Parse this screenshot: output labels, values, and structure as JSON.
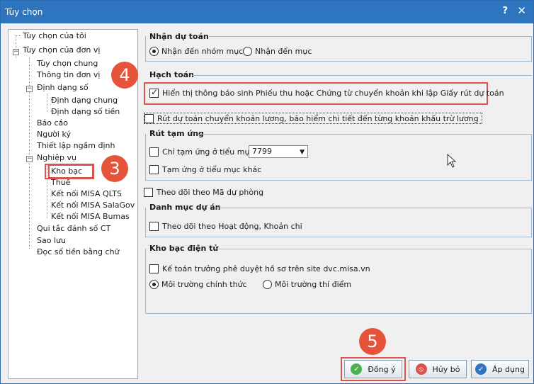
{
  "window": {
    "title": "Tùy chọn",
    "help": "?",
    "close": "✕"
  },
  "tree": {
    "items": [
      "Tùy chọn của tôi",
      "Tùy chọn của đơn vị",
      "Tùy chọn chung",
      "Thông tin đơn vị",
      "Định dạng số",
      "Định dạng chung",
      "Định dạng số tiền",
      "Báo cáo",
      "Người ký",
      "Thiết lập ngầm định",
      "Nghiệp vụ",
      "Kho bạc",
      "Thuế",
      "Kết nối MISA QLTS",
      "Kết nối MISA SalaGov",
      "Kết nối MISA Bumas",
      "Qui tắc đánh số CT",
      "Sao lưu",
      "Đọc số tiền bằng chữ"
    ]
  },
  "nhan_du_toan": {
    "title": "Nhận dự toán",
    "opt1": "Nhận đến nhóm mục",
    "opt2": "Nhận đến mục"
  },
  "hach_toan": {
    "title": "Hạch toán",
    "chk1": "Hiển thị thông báo sinh Phiếu thu hoặc Chứng từ chuyển khoản khi lập Giấy rút dự toán"
  },
  "rut_du_toan": "Rút dự toán chuyển khoản lương, bảo hiểm chi tiết đến từng khoản khấu trừ lương",
  "rut_tam_ung": {
    "title": "Rút tạm ứng",
    "chk1": "Chỉ tạm ứng ở tiểu mục",
    "select_value": "7799",
    "chk2": "Tạm ứng ở tiểu mục khác"
  },
  "theo_doi_ma_du_phong": "Theo dõi theo Mã dự phòng",
  "danh_muc_du_an": {
    "title": "Danh mục dự án",
    "chk1": "Theo dõi theo Hoạt động, Khoản chi"
  },
  "kho_bac_dien_tu": {
    "title": "Kho bạc điện tử",
    "chk1": "Kế toán trưởng phê duyệt hồ sơ trên site dvc.misa.vn",
    "opt1": "Môi trường chính thức",
    "opt2": "Môi trường thí điểm"
  },
  "buttons": {
    "ok": "Đồng ý",
    "cancel": "Hủy bỏ",
    "apply": "Áp dụng"
  },
  "badges": {
    "b3": "3",
    "b4": "4",
    "b5": "5"
  },
  "colors": {
    "accent": "#2e75c0",
    "highlight": "#d9534f",
    "badge": "#e5533a"
  }
}
